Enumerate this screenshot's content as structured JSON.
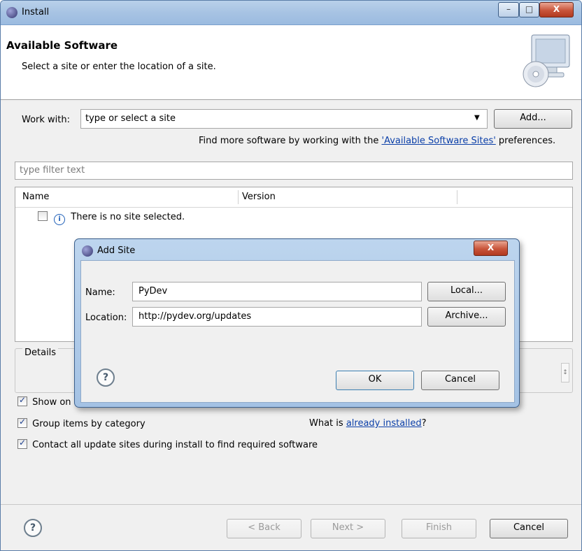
{
  "window": {
    "title": "Install",
    "controls": {
      "minimize": "–",
      "maximize": "□",
      "close": "X"
    }
  },
  "header": {
    "title": "Available Software",
    "subtitle": "Select a site or enter the location of a site."
  },
  "work_with": {
    "label": "Work with:",
    "value": "type or select a site",
    "add_button": "Add...",
    "find_more_prefix": "Find more software by working with the ",
    "find_more_link": "'Available Software Sites'",
    "find_more_suffix": " preferences."
  },
  "filter": {
    "placeholder": "type filter text"
  },
  "table": {
    "columns": [
      "Name",
      "Version"
    ],
    "rows": [
      {
        "checked": false,
        "text": "There is no site selected."
      }
    ]
  },
  "details": {
    "label": "Details"
  },
  "options": {
    "show_only_latest": "Show on",
    "group_by_category": "Group items by category",
    "already_installed_prefix": "What is ",
    "already_installed_link": "already installed",
    "already_installed_suffix": "?",
    "contact_update_sites": "Contact all update sites during install to find required software"
  },
  "footer": {
    "back": "< Back",
    "next": "Next >",
    "finish": "Finish",
    "cancel": "Cancel"
  },
  "dialog": {
    "title": "Add Site",
    "close": "X",
    "name_label": "Name:",
    "name_value": "PyDev",
    "location_label": "Location:",
    "location_value": "http://pydev.org/updates",
    "local_button": "Local...",
    "archive_button": "Archive...",
    "ok_button": "OK",
    "cancel_button": "Cancel"
  }
}
